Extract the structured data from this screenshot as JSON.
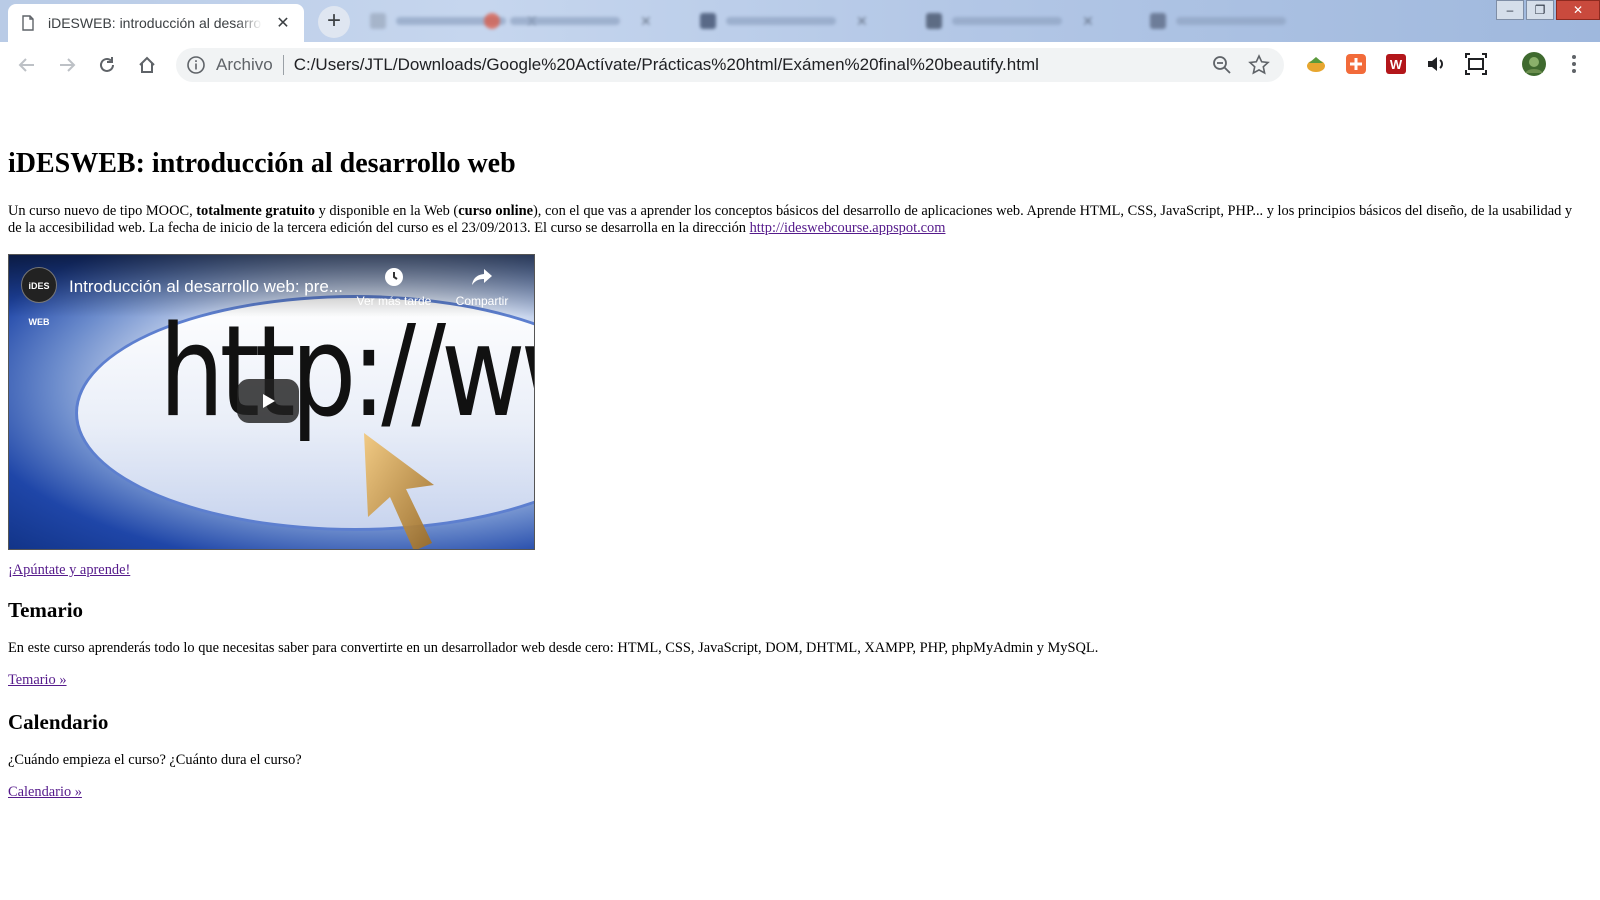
{
  "browser": {
    "active_tab": {
      "title": "iDESWEB: introducción al desarrollo web"
    },
    "new_tab_label": "+",
    "close_label": "✕",
    "omnibox": {
      "scheme_label": "Archivo",
      "url": "C:/Users/JTL/Downloads/Google%20Actívate/Prácticas%20html/Exámen%20final%20beautify.html"
    },
    "window_controls": [
      "–",
      "❐",
      "✕"
    ]
  },
  "page": {
    "heading": "iDESWEB: introducción al desarrollo web",
    "intro": {
      "t1": "Un curso nuevo de tipo MOOC, ",
      "b1": "totalmente gratuito",
      "t2": " y disponible en la Web (",
      "b2": "curso online",
      "t3": "), con el que vas a aprender los conceptos básicos del desarrollo de aplicaciones web. Aprende HTML, CSS, JavaScript, PHP... y los principios básicos del diseño, de la usabilidad y de la accesibilidad web. La fecha de inicio de la tercera edición del curso es el 23/09/2013. El curso se desarrolla en la dirección ",
      "link": "http://ideswebcourse.appspot.com"
    },
    "video": {
      "channel_logo": "iDES WEB",
      "title": "Introducción al desarrollo web: pre...",
      "watch_later": "Ver más tarde",
      "share": "Compartir",
      "thumbnail_text": "http://www."
    },
    "cta_link": "¡Apúntate y aprende!",
    "temario": {
      "heading": "Temario",
      "body": "En este curso aprenderás todo lo que necesitas saber para convertirte en un desarrollador web desde cero: HTML, CSS, JavaScript, DOM, DHTML, XAMPP, PHP, phpMyAdmin y MySQL.",
      "link": "Temario »"
    },
    "calendario": {
      "heading": "Calendario",
      "body": "¿Cuándo empieza el curso? ¿Cuánto dura el curso?",
      "link": "Calendario »"
    }
  },
  "colors": {
    "link_visited": "#551a8b",
    "omnibox_bg": "#f1f3f4",
    "tabstrip": "#b9cbe6"
  },
  "icons": [
    "document-icon",
    "close-icon",
    "back-icon",
    "forward-icon",
    "reload-icon",
    "home-icon",
    "info-icon",
    "zoom-icon",
    "star-icon",
    "extension-icon",
    "menu-icon",
    "play-icon",
    "clock-icon",
    "share-icon"
  ]
}
